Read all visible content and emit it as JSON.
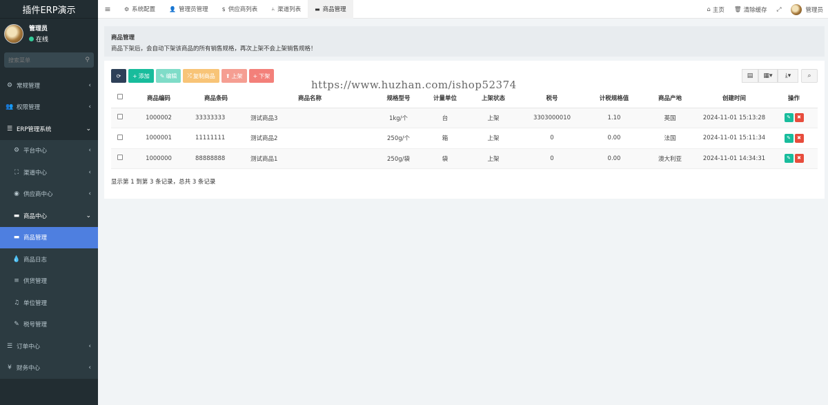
{
  "app": {
    "title": "插件ERP演示"
  },
  "user": {
    "name": "管理员",
    "status": "在线"
  },
  "sidebar": {
    "search_placeholder": "搜索菜单",
    "items": [
      {
        "label": "常规管理",
        "icon": "cogs-icon"
      },
      {
        "label": "权限管理",
        "icon": "group-icon"
      },
      {
        "label": "ERP管理系统",
        "icon": "list-icon"
      },
      {
        "label": "平台中心",
        "icon": "gear-icon"
      },
      {
        "label": "渠道中心",
        "icon": "sitemap-icon"
      },
      {
        "label": "供应商中心",
        "icon": "compass-icon"
      },
      {
        "label": "商品中心",
        "icon": "briefcase-icon"
      },
      {
        "label": "商品管理",
        "icon": "briefcase-icon"
      },
      {
        "label": "商品日志",
        "icon": "tint-icon"
      },
      {
        "label": "供货管理",
        "icon": "list-icon"
      },
      {
        "label": "单位管理",
        "icon": "music-icon"
      },
      {
        "label": "税号管理",
        "icon": "pencil-icon"
      },
      {
        "label": "订单中心",
        "icon": "list-icon"
      },
      {
        "label": "财务中心",
        "icon": "yen-icon"
      }
    ]
  },
  "topbar": {
    "tabs": [
      {
        "label": "系统配置",
        "icon": "gear-icon"
      },
      {
        "label": "管理员管理",
        "icon": "user-icon"
      },
      {
        "label": "供应商列表",
        "icon": "dollar-icon"
      },
      {
        "label": "渠道列表",
        "icon": "share-icon"
      },
      {
        "label": "商品管理",
        "icon": "briefcase-icon"
      }
    ],
    "home": "主页",
    "clear_cache": "清除缓存",
    "admin": "管理员"
  },
  "page": {
    "title": "商品管理",
    "desc": "商品下架后，会自动下架该商品的所有销售规格，再次上架不会上架销售规格！"
  },
  "toolbar": {
    "add": "添加",
    "edit": "编辑",
    "copy": "复制商品",
    "up": "上架",
    "down": "下架"
  },
  "watermark": "https://www.huzhan.com/ishop52374",
  "table": {
    "headers": [
      "商品编码",
      "商品条码",
      "商品名称",
      "规格型号",
      "计量单位",
      "上架状态",
      "税号",
      "计税规格值",
      "商品产地",
      "创建时间",
      "操作"
    ],
    "rows": [
      [
        "1000002",
        "33333333",
        "测试商品3",
        "1kg/个",
        "台",
        "上架",
        "3303000010",
        "1.10",
        "英国",
        "2024-11-01 15:13:28"
      ],
      [
        "1000001",
        "11111111",
        "测试商品2",
        "250g/个",
        "箱",
        "上架",
        "0",
        "0.00",
        "法国",
        "2024-11-01 15:11:34"
      ],
      [
        "1000000",
        "88888888",
        "测试商品1",
        "250g/袋",
        "袋",
        "上架",
        "0",
        "0.00",
        "澳大利亚",
        "2024-11-01 14:34:31"
      ]
    ]
  },
  "footer": "显示第 1 到第 3 条记录，总共 3 条记录"
}
